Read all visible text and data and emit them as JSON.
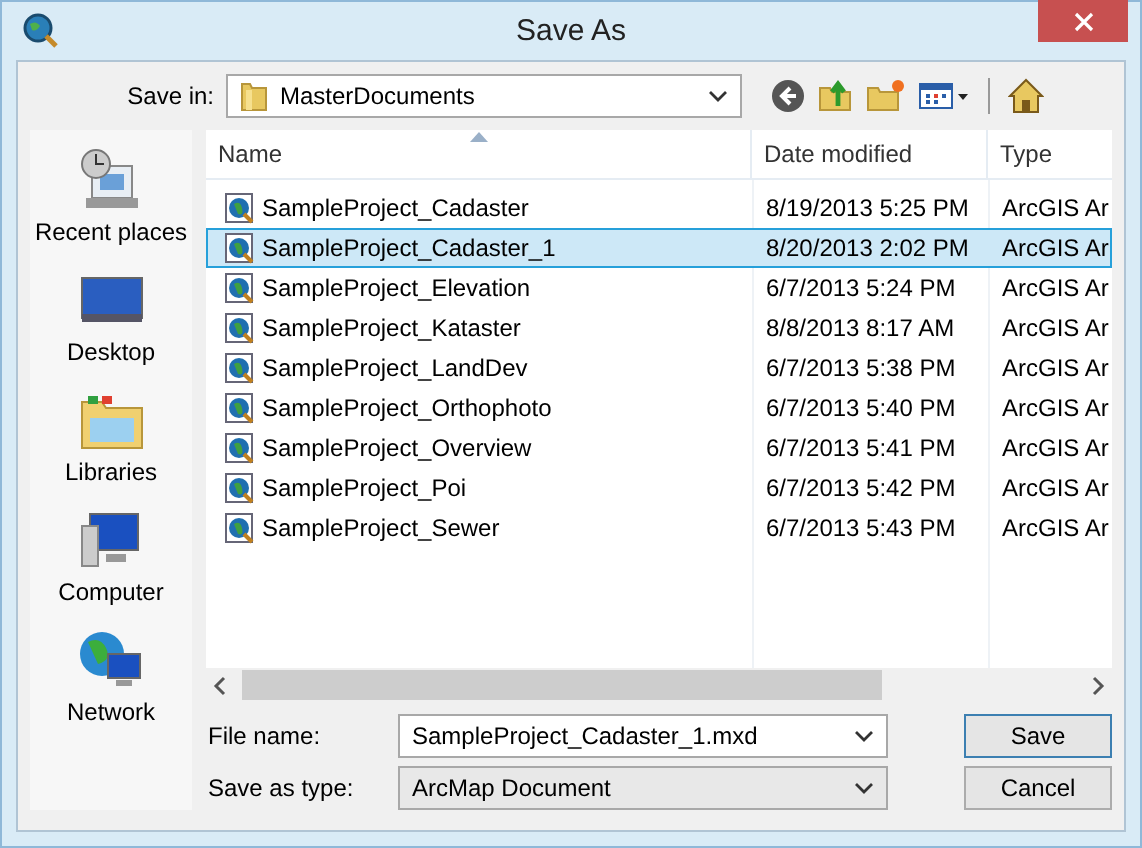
{
  "window": {
    "title": "Save As"
  },
  "save_in": {
    "label": "Save in:",
    "value": "MasterDocuments"
  },
  "places": [
    {
      "kind": "recent",
      "label": "Recent places"
    },
    {
      "kind": "desktop",
      "label": "Desktop"
    },
    {
      "kind": "libraries",
      "label": "Libraries"
    },
    {
      "kind": "computer",
      "label": "Computer"
    },
    {
      "kind": "network",
      "label": "Network"
    }
  ],
  "table": {
    "columns": [
      "Name",
      "Date modified",
      "Type"
    ],
    "rows": [
      {
        "name": "SampleProject_Cadaster",
        "date": "8/19/2013 5:25 PM",
        "type": "ArcGIS Ar",
        "selected": false
      },
      {
        "name": "SampleProject_Cadaster_1",
        "date": "8/20/2013 2:02 PM",
        "type": "ArcGIS Ar",
        "selected": true
      },
      {
        "name": "SampleProject_Elevation",
        "date": "6/7/2013 5:24 PM",
        "type": "ArcGIS Ar",
        "selected": false
      },
      {
        "name": "SampleProject_Kataster",
        "date": "8/8/2013 8:17 AM",
        "type": "ArcGIS Ar",
        "selected": false
      },
      {
        "name": "SampleProject_LandDev",
        "date": "6/7/2013 5:38 PM",
        "type": "ArcGIS Ar",
        "selected": false
      },
      {
        "name": "SampleProject_Orthophoto",
        "date": "6/7/2013 5:40 PM",
        "type": "ArcGIS Ar",
        "selected": false
      },
      {
        "name": "SampleProject_Overview",
        "date": "6/7/2013 5:41 PM",
        "type": "ArcGIS Ar",
        "selected": false
      },
      {
        "name": "SampleProject_Poi",
        "date": "6/7/2013 5:42 PM",
        "type": "ArcGIS Ar",
        "selected": false
      },
      {
        "name": "SampleProject_Sewer",
        "date": "6/7/2013 5:43 PM",
        "type": "ArcGIS Ar",
        "selected": false
      }
    ]
  },
  "file_name": {
    "label": "File name:",
    "value": "SampleProject_Cadaster_1.mxd"
  },
  "save_as_type": {
    "label": "Save as type:",
    "value": "ArcMap Document"
  },
  "buttons": [
    "Save",
    "Cancel"
  ]
}
